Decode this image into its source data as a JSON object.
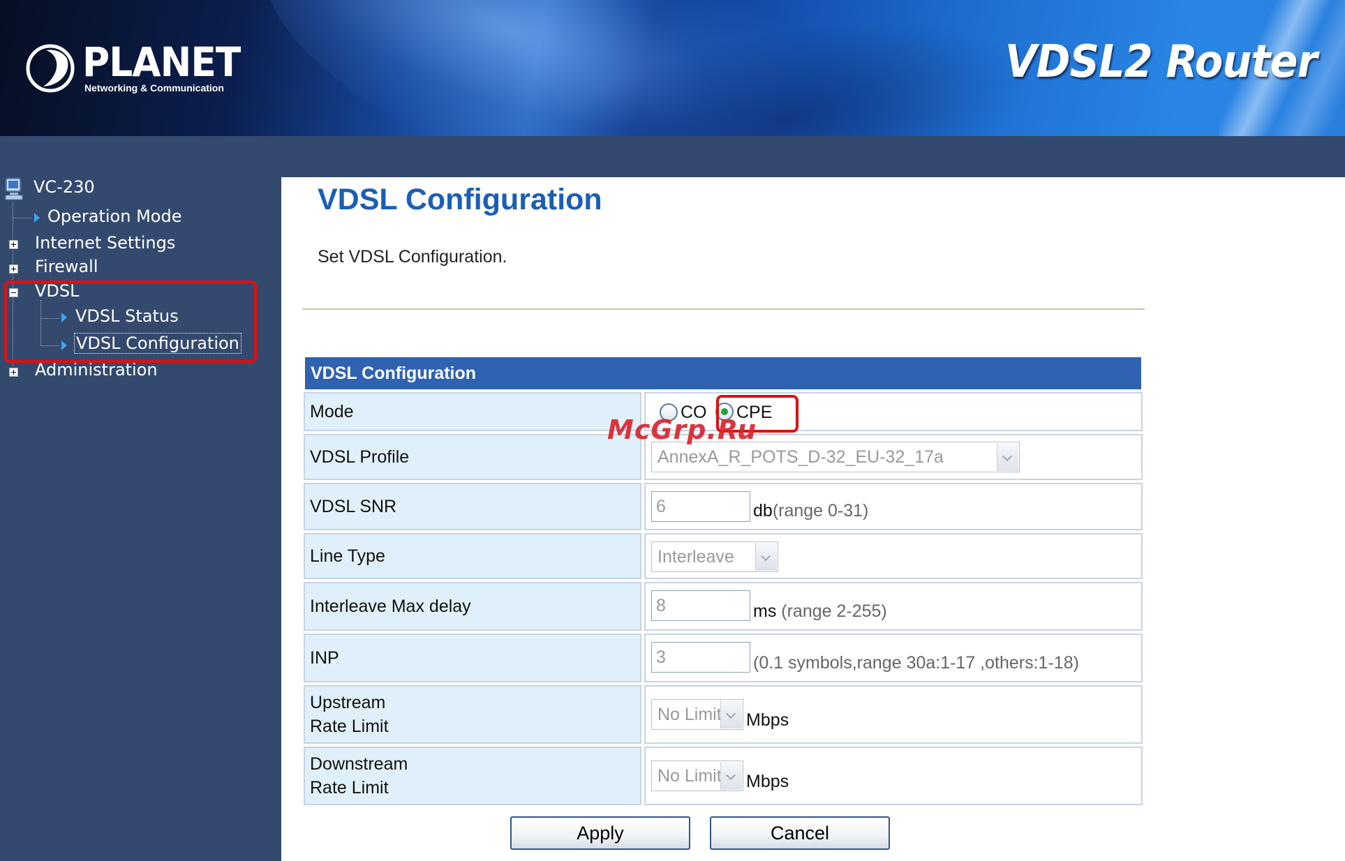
{
  "header": {
    "brand_name": "PLANET",
    "brand_tagline": "Networking & Communication",
    "product_title": "VDSL2 Router"
  },
  "sidebar": {
    "root_label": "VC-230",
    "items": [
      {
        "label": "Operation Mode"
      },
      {
        "label": "Internet Settings"
      },
      {
        "label": "Firewall"
      },
      {
        "label": "VDSL"
      },
      {
        "label": "VDSL Status"
      },
      {
        "label": "VDSL Configuration"
      },
      {
        "label": "Administration"
      }
    ]
  },
  "main": {
    "title": "VDSL Configuration",
    "description": "Set VDSL Configuration.",
    "form": {
      "header": "VDSL Configuration",
      "mode": {
        "label": "Mode",
        "option_co": "CO",
        "option_cpe": "CPE",
        "selected": "CPE"
      },
      "profile": {
        "label": "VDSL Profile",
        "value": "AnnexA_R_POTS_D-32_EU-32_17a"
      },
      "snr": {
        "label": "VDSL SNR",
        "value": "6",
        "unit": "db",
        "hint": "(range 0-31)"
      },
      "line_type": {
        "label": "Line Type",
        "value": "Interleave"
      },
      "max_delay": {
        "label": "Interleave Max delay",
        "value": "8",
        "unit": "ms",
        "hint": "(range 2-255)"
      },
      "inp": {
        "label": "INP",
        "value": "3",
        "hint": "(0.1 symbols,range 30a:1-17 ,others:1-18)"
      },
      "upstream": {
        "label_line1": "Upstream",
        "label_line2": "Rate Limit",
        "value": "No Limit",
        "unit": "Mbps"
      },
      "downstream": {
        "label_line1": "Downstream",
        "label_line2": "Rate Limit",
        "value": "No Limit",
        "unit": "Mbps"
      }
    },
    "buttons": {
      "apply": "Apply",
      "cancel": "Cancel"
    }
  },
  "watermark": "McGrp.Ru",
  "colors": {
    "header_bg": "#1451b0",
    "sidebar_bg": "#34496e",
    "table_header": "#2f62b0",
    "label_cell": "#e0f0fa",
    "title": "#1a5fb4",
    "highlight": "#e01010"
  }
}
